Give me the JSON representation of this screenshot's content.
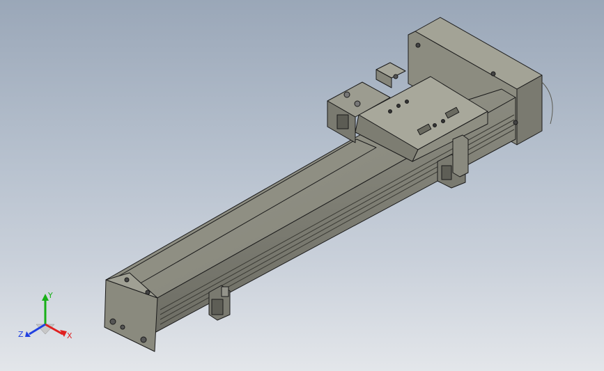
{
  "viewport": {
    "background_top": "#9aa7b8",
    "background_bottom": "#e3e6ea"
  },
  "model": {
    "body_color": "#8c8c80",
    "body_dark": "#6b6b62",
    "body_light": "#a9a99c",
    "edge_color": "#1a1a1a"
  },
  "triad": {
    "x_label": "X",
    "y_label": "Y",
    "z_label": "Z",
    "x_color": "#e02020",
    "y_color": "#18b018",
    "z_color": "#2040e0"
  }
}
